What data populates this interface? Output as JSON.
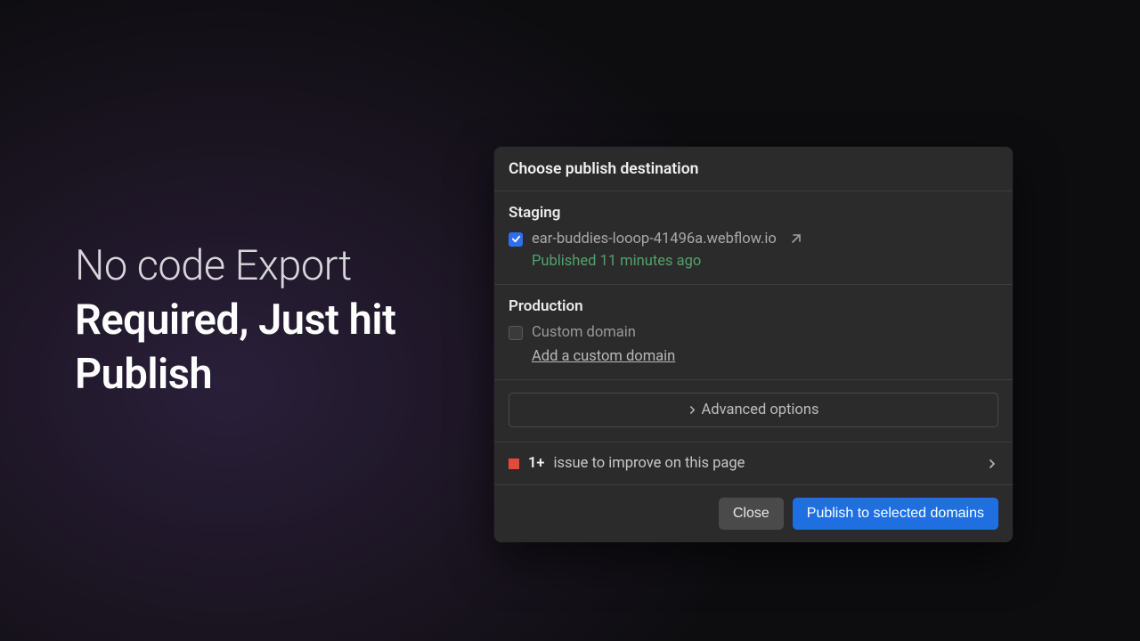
{
  "hero": {
    "line1": "No code Export",
    "line2": "Required, Just hit Publish"
  },
  "panel": {
    "title": "Choose publish destination",
    "staging": {
      "label": "Staging",
      "domain": "ear-buddies-looop-41496a.webflow.io",
      "checked": true,
      "status": "Published 11 minutes ago"
    },
    "production": {
      "label": "Production",
      "custom_label": "Custom domain",
      "checked": false,
      "add_link": "Add a custom domain"
    },
    "advanced_label": "Advanced options",
    "issue": {
      "count": "1+",
      "text": "issue to improve on this page"
    },
    "close_label": "Close",
    "publish_label": "Publish to selected domains"
  },
  "colors": {
    "accent": "#1f6fe0",
    "success": "#4fa36a",
    "error": "#e24a3b"
  }
}
